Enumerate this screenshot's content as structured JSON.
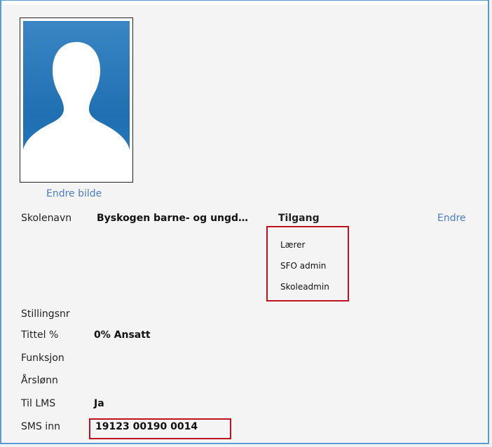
{
  "profile": {
    "change_photo_label": "Endre bilde"
  },
  "school": {
    "label": "Skolenavn",
    "value": "Byskogen barne- og ungd…",
    "access_header": "Tilgang",
    "edit_label": "Endre",
    "roles": [
      "Lærer",
      "SFO admin",
      "Skoleadmin"
    ]
  },
  "fields": [
    {
      "label": "Stillingsnr",
      "value": ""
    },
    {
      "label": "Tittel %",
      "value": "0% Ansatt"
    },
    {
      "label": "Funksjon",
      "value": ""
    },
    {
      "label": "Årslønn",
      "value": ""
    },
    {
      "label": "Til LMS",
      "value": "Ja"
    },
    {
      "label": "SMS inn",
      "value": "19123 00190 0014"
    }
  ],
  "colors": {
    "link": "#4a7fc1",
    "highlight_border": "#c0111f",
    "frame_border": "#5b9bd5",
    "photo_background": "#2a7fbf"
  },
  "icons": {
    "photo": "person-silhouette-icon"
  }
}
